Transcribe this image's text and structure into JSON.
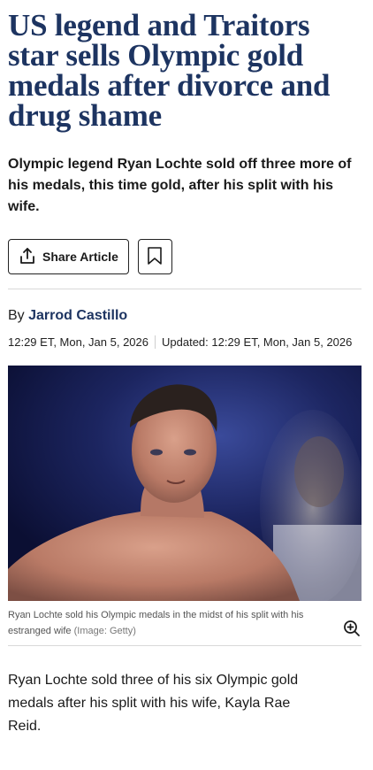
{
  "article": {
    "headline": "US legend and Traitors star sells Olympic gold medals after divorce and drug shame",
    "standfirst": "Olympic legend Ryan Lochte sold off three more of his medals, this time gold, after his split with his wife.",
    "share_label": "Share Article",
    "byline_prefix": "By",
    "author": "Jarrod Castillo",
    "published": "12:29 ET, Mon, Jan 5, 2026",
    "updated": "Updated: 12:29 ET, Mon, Jan 5, 2026",
    "image": {
      "caption": "Ryan Lochte sold his Olympic medals in the midst of his split with his estranged wife",
      "credit": "(Image: Getty)"
    },
    "first_paragraph": "Ryan Lochte sold three of his six Olympic gold medals after his split with his wife, Kayla Rae Reid."
  },
  "icons": {
    "share": "share-icon",
    "bookmark": "bookmark-icon",
    "zoom": "zoom-in-icon"
  },
  "colors": {
    "headline": "#1d3461",
    "author": "#1d3461",
    "divider": "#d9d9d9"
  }
}
